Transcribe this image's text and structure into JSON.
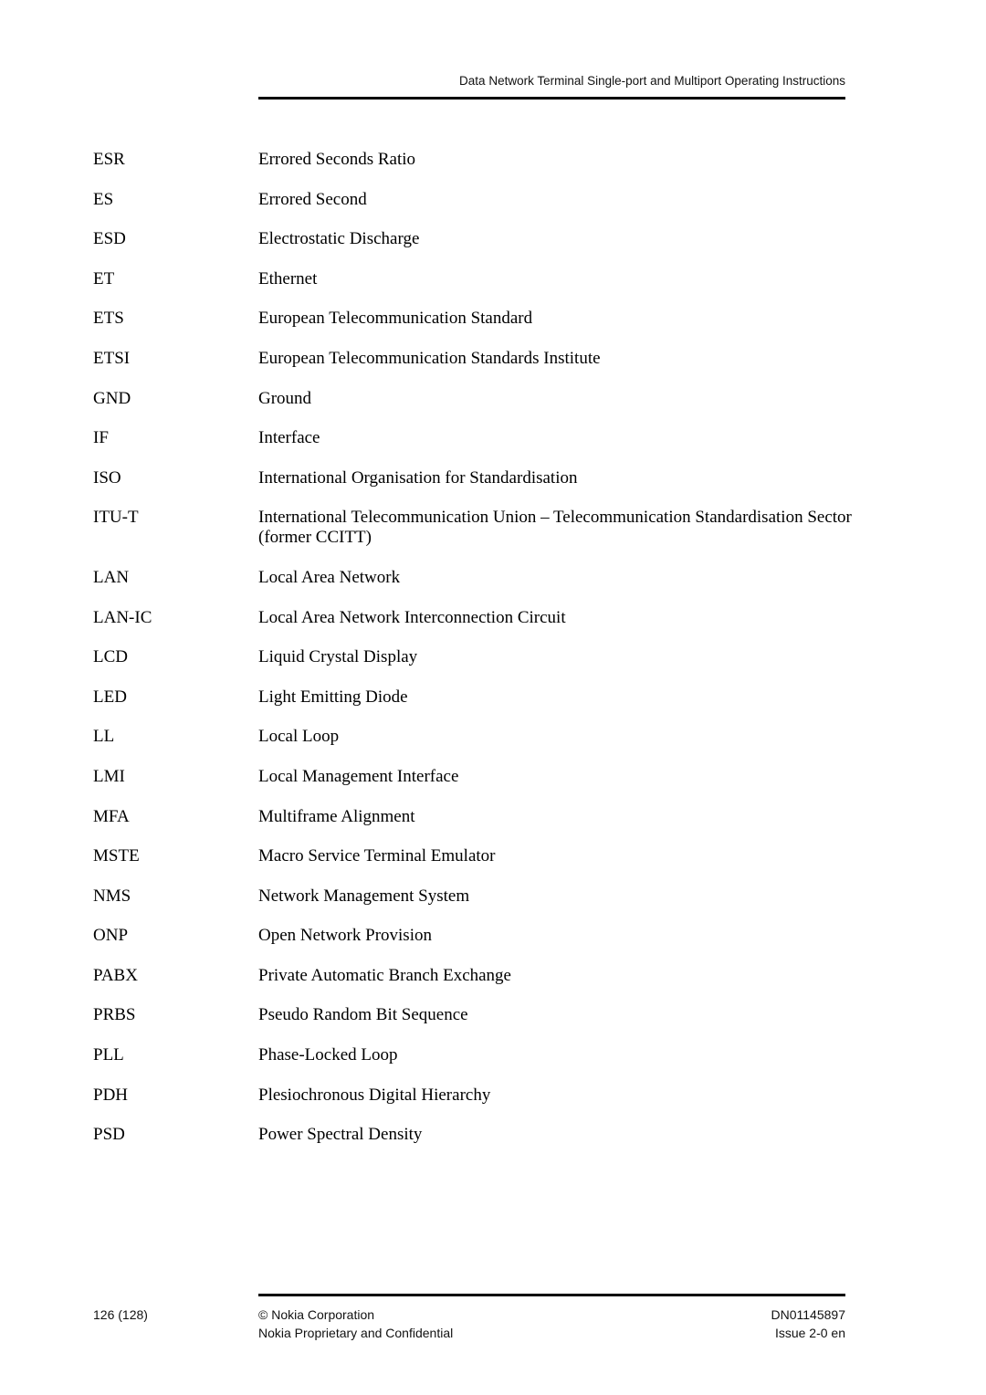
{
  "header": {
    "title": "Data Network Terminal Single-port and Multiport Operating Instructions"
  },
  "glossary": [
    {
      "abbr": "ESR",
      "definition": "Errored Seconds Ratio"
    },
    {
      "abbr": "ES",
      "definition": "Errored Second"
    },
    {
      "abbr": "ESD",
      "definition": "Electrostatic Discharge"
    },
    {
      "abbr": "ET",
      "definition": "Ethernet"
    },
    {
      "abbr": "ETS",
      "definition": "European Telecommunication Standard"
    },
    {
      "abbr": "ETSI",
      "definition": "European Telecommunication Standards Institute"
    },
    {
      "abbr": "GND",
      "definition": "Ground"
    },
    {
      "abbr": "IF",
      "definition": "Interface"
    },
    {
      "abbr": "ISO",
      "definition": "International Organisation for Standardisation"
    },
    {
      "abbr": "ITU-T",
      "definition": "International Telecommunication Union – Telecommunication Standardisation Sector (former CCITT)"
    },
    {
      "abbr": "LAN",
      "definition": "Local Area Network"
    },
    {
      "abbr": "LAN-IC",
      "definition": "Local Area Network Interconnection Circuit"
    },
    {
      "abbr": "LCD",
      "definition": "Liquid Crystal Display"
    },
    {
      "abbr": "LED",
      "definition": "Light Emitting Diode"
    },
    {
      "abbr": "LL",
      "definition": "Local Loop"
    },
    {
      "abbr": "LMI",
      "definition": "Local Management Interface"
    },
    {
      "abbr": "MFA",
      "definition": "Multiframe Alignment"
    },
    {
      "abbr": "MSTE",
      "definition": "Macro Service Terminal Emulator"
    },
    {
      "abbr": "NMS",
      "definition": "Network Management System"
    },
    {
      "abbr": "ONP",
      "definition": "Open Network Provision"
    },
    {
      "abbr": "PABX",
      "definition": "Private Automatic Branch Exchange"
    },
    {
      "abbr": "PRBS",
      "definition": "Pseudo Random Bit Sequence"
    },
    {
      "abbr": "PLL",
      "definition": "Phase-Locked Loop"
    },
    {
      "abbr": "PDH",
      "definition": "Plesiochronous Digital Hierarchy"
    },
    {
      "abbr": "PSD",
      "definition": "Power Spectral Density"
    }
  ],
  "footer": {
    "page": "126 (128)",
    "copyright": "© Nokia Corporation",
    "confidentiality": "Nokia Proprietary and Confidential",
    "doc_number": "DN01145897",
    "issue": "Issue 2-0 en"
  }
}
